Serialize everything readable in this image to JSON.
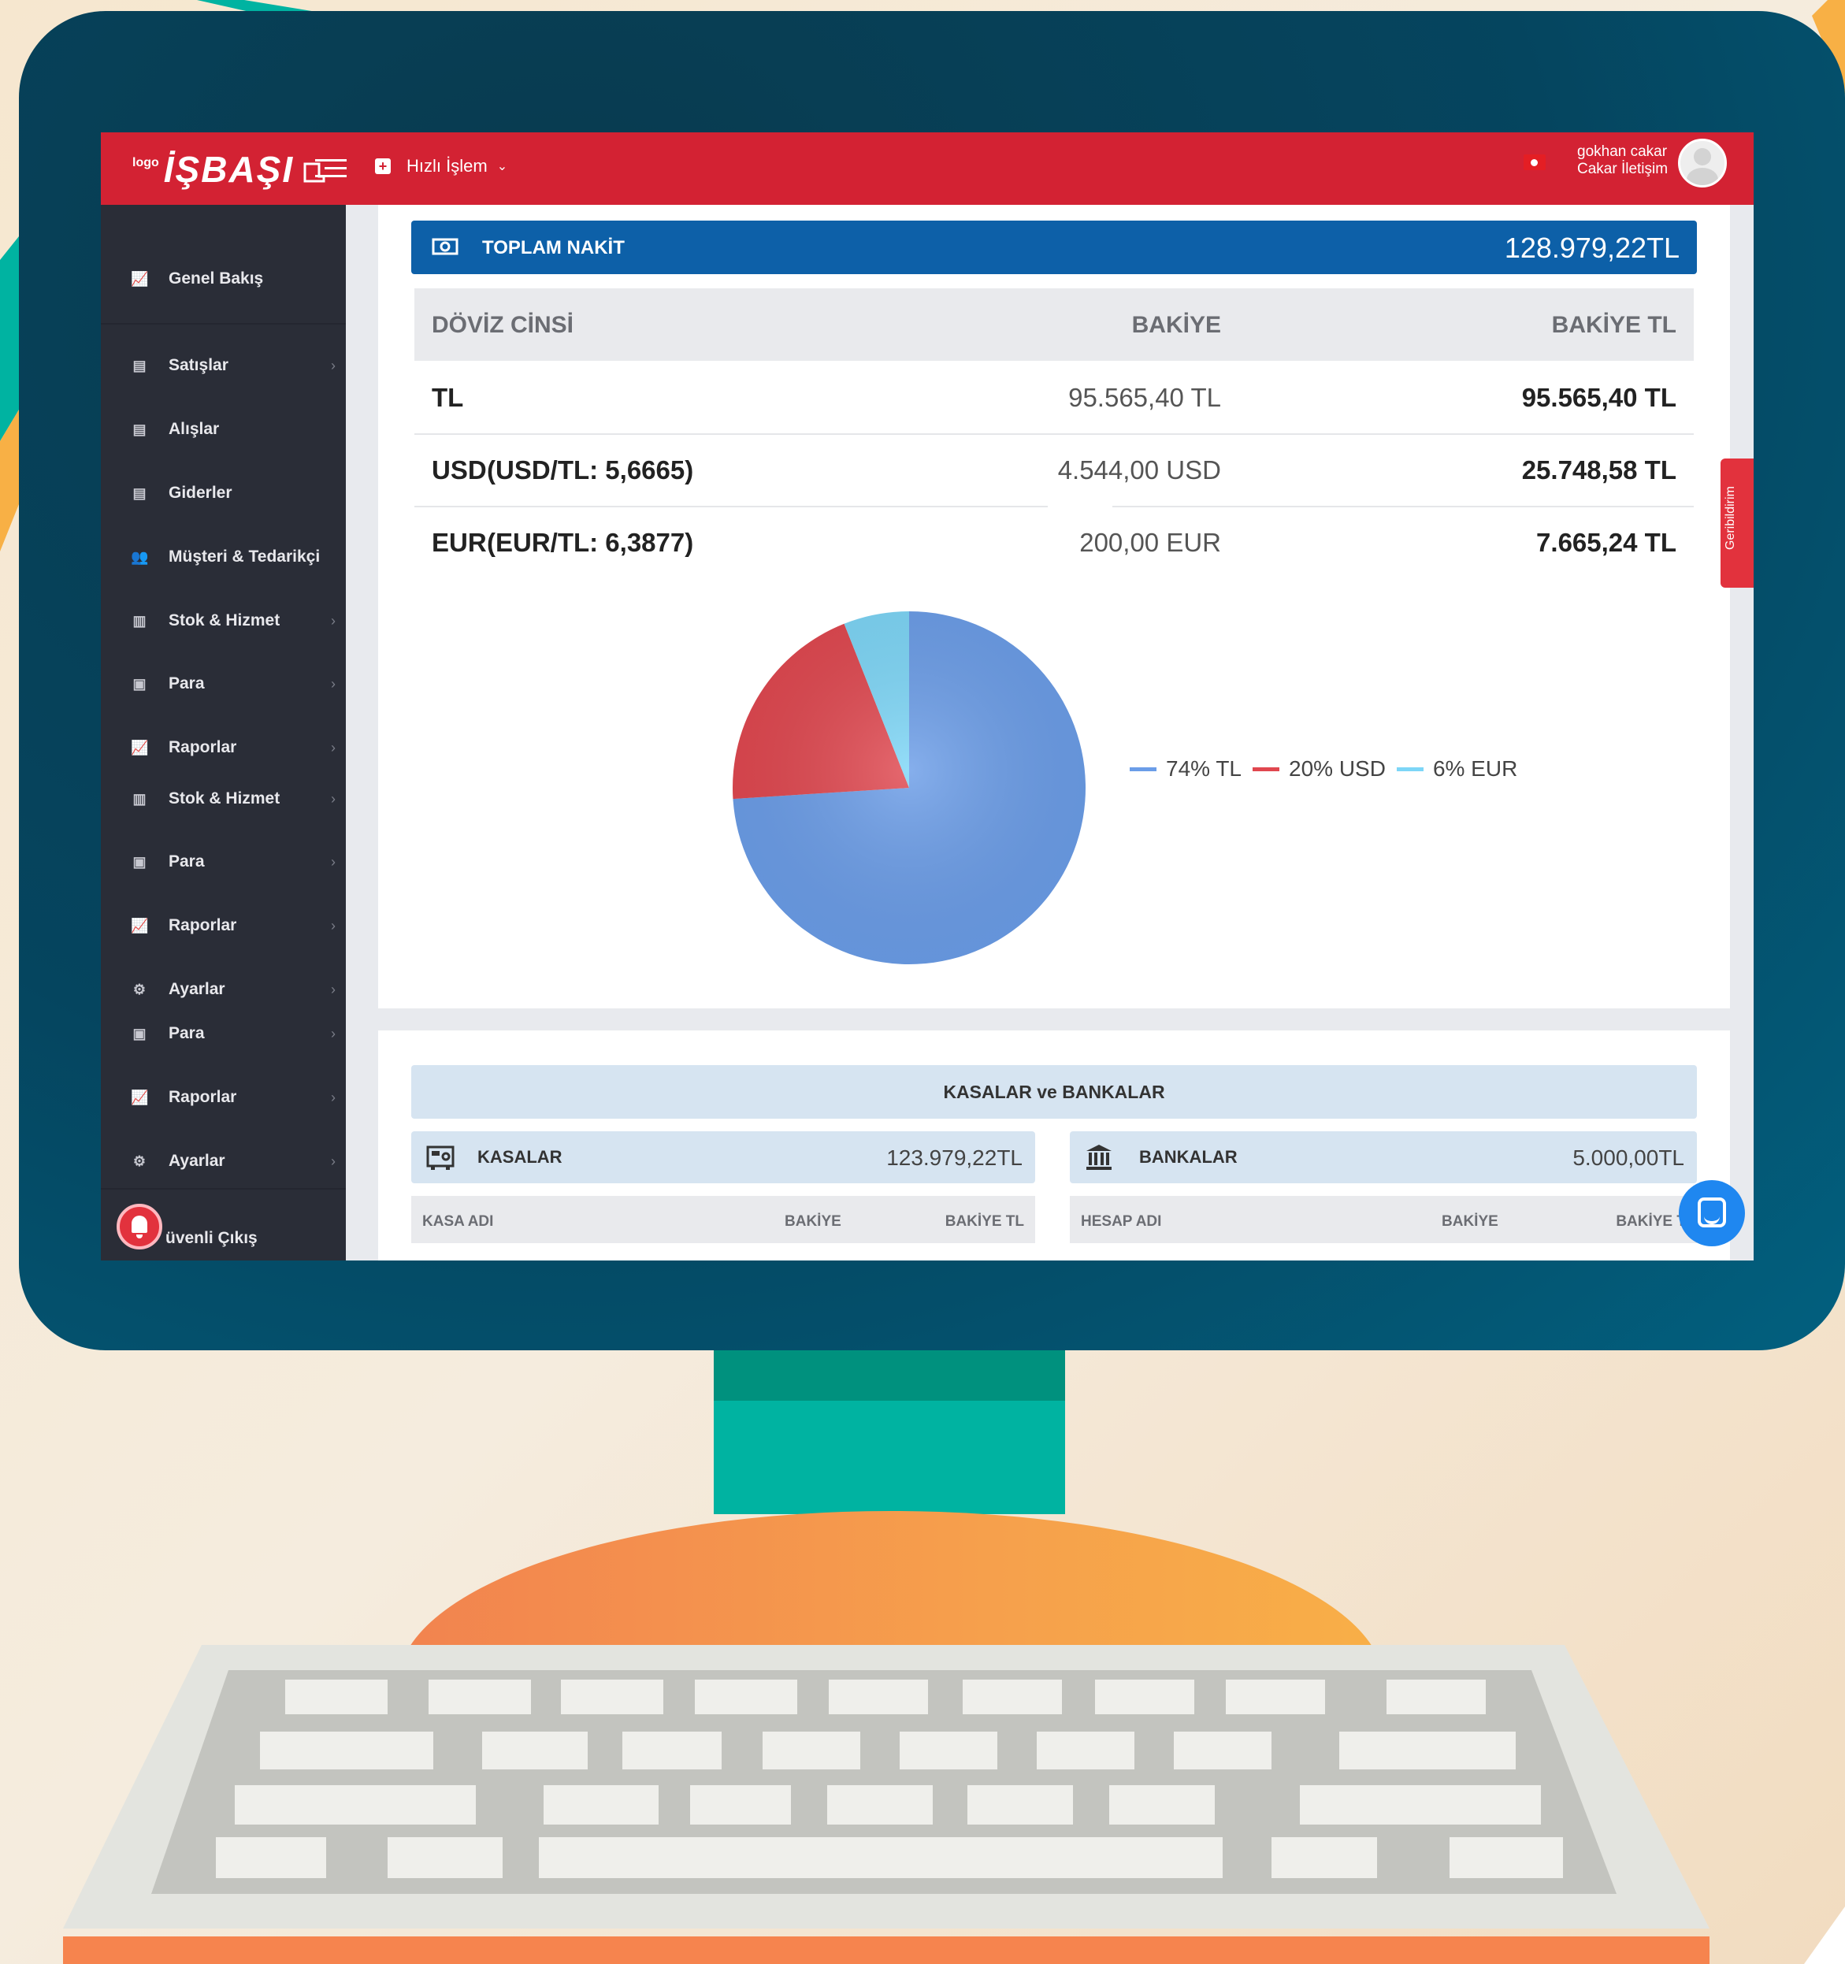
{
  "app": {
    "logo_small": "logo",
    "logo_big": "İŞBAŞI",
    "quick_action": "Hızlı İşlem",
    "user_name": "gokhan cakar",
    "user_company": "Cakar İletişim",
    "accent": "#d32233"
  },
  "sidebar": {
    "items": [
      {
        "label": "Genel Bakış",
        "icon": "chart-icon"
      },
      {
        "label": "Satışlar",
        "icon": "document-icon"
      },
      {
        "label": "Alışlar",
        "icon": "document-icon"
      },
      {
        "label": "Giderler",
        "icon": "document-icon"
      },
      {
        "label": "Müşteri & Tedarikçi",
        "icon": "users-icon"
      },
      {
        "label": "Stok & Hizmet",
        "icon": "barcode-icon"
      },
      {
        "label": "Para",
        "icon": "money-icon"
      },
      {
        "label": "Raporlar",
        "icon": "chart-icon"
      },
      {
        "label": "Stok & Hizmet",
        "icon": "barcode-icon"
      },
      {
        "label": "Para",
        "icon": "money-icon"
      },
      {
        "label": "Raporlar",
        "icon": "chart-icon"
      },
      {
        "label": "Ayarlar",
        "icon": "gear-icon"
      },
      {
        "label": "Para",
        "icon": "money-icon"
      },
      {
        "label": "Raporlar",
        "icon": "chart-icon"
      },
      {
        "label": "Ayarlar",
        "icon": "gear-icon"
      }
    ],
    "logout": "üvenli Çıkış"
  },
  "cash": {
    "title": "TOPLAM NAKİT",
    "total": "128.979,22TL",
    "headers": {
      "currency": "DÖVİZ CİNSİ",
      "balance": "BAKİYE",
      "balance_tl": "BAKİYE TL"
    },
    "rows": [
      {
        "code": "TL",
        "rate": "",
        "balance": "95.565,40 TL",
        "balance_tl": "95.565,40 TL"
      },
      {
        "code": "USD",
        "rate": "(USD/TL: 5,6665)",
        "balance": "4.544,00 USD",
        "balance_tl": "25.748,58 TL"
      },
      {
        "code": "EUR",
        "rate": "(EUR/TL: 6,3877)",
        "balance": "200,00 EUR",
        "balance_tl": "7.665,24 TL"
      }
    ]
  },
  "chart_data": {
    "type": "pie",
    "categories": [
      "TL",
      "USD",
      "EUR"
    ],
    "values": [
      74,
      20,
      6
    ],
    "legend": [
      "74% TL",
      "20% USD",
      "6% EUR"
    ],
    "colors": [
      "#6b9de8",
      "#e0474f",
      "#7dd6f7"
    ],
    "legend_position": "right"
  },
  "accounts": {
    "title": "KASALAR ve BANKALAR",
    "kasalar": {
      "label": "KASALAR",
      "total": "123.979,22TL",
      "cols": [
        "KASA ADI",
        "BAKİYE",
        "BAKİYE TL"
      ]
    },
    "bankalar": {
      "label": "BANKALAR",
      "total": "5.000,00TL",
      "cols": [
        "HESAP ADI",
        "BAKİYE",
        "BAKİYE T"
      ]
    }
  },
  "feedback": "Geribildirim"
}
